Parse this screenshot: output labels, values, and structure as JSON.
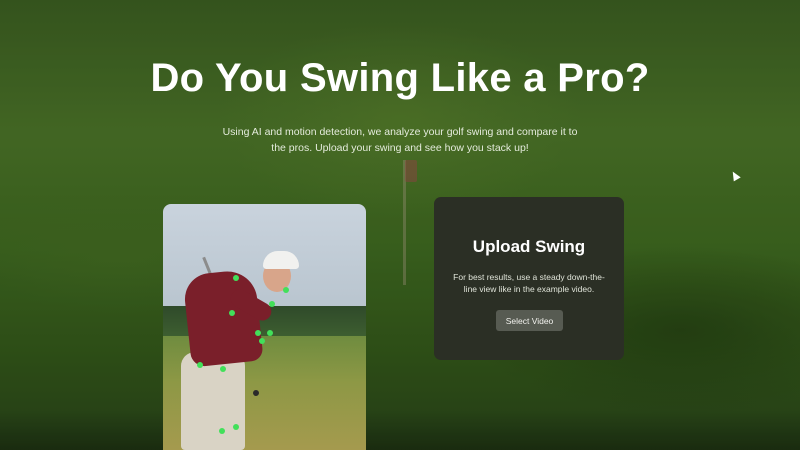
{
  "hero": {
    "title": "Do You Swing Like a Pro?",
    "subtitle": "Using AI and motion detection, we analyze your golf swing and compare it to the pros. Upload your swing and see how you stack up!"
  },
  "upload": {
    "title": "Upload Swing",
    "description": "For best results, use a steady down-the-line view like in the example video.",
    "button_label": "Select Video"
  },
  "colors": {
    "keypoint": "#42e05a",
    "card_bg": "#2b2f25",
    "button_bg": "#575b52"
  }
}
